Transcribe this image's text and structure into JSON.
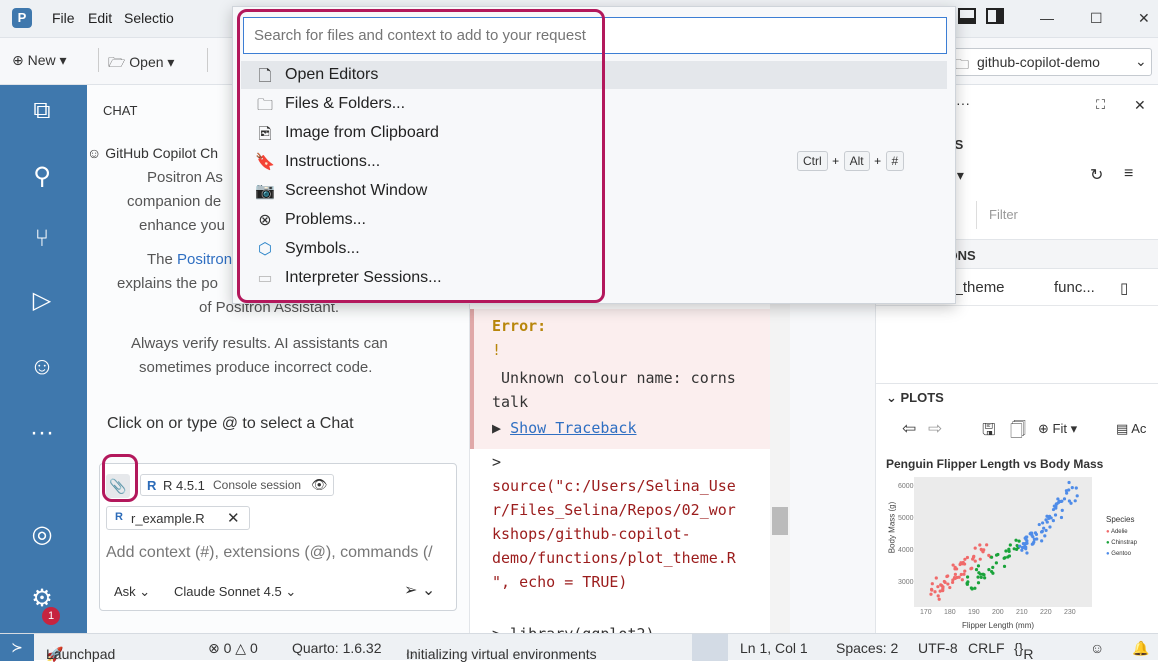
{
  "menubar": {
    "items": [
      "File",
      "Edit",
      "Selectio"
    ],
    "window_controls": [
      "—",
      "☐",
      "✕"
    ]
  },
  "toolbar": {
    "new_label": "New",
    "open_label": "Open",
    "workspace": "github-copilot-demo"
  },
  "quickpick": {
    "placeholder": "Search for files and context to add to your request",
    "items": [
      {
        "icon": "file-icon",
        "glyph": "🗋",
        "label": "Open Editors"
      },
      {
        "icon": "folder-icon",
        "glyph": "🗀",
        "label": "Files & Folders..."
      },
      {
        "icon": "image-clipboard-icon",
        "glyph": "🖻",
        "label": "Image from Clipboard"
      },
      {
        "icon": "bookmark-icon",
        "glyph": "🔖",
        "label": "Instructions..."
      },
      {
        "icon": "camera-icon",
        "glyph": "📷",
        "label": "Screenshot Window"
      },
      {
        "icon": "error-circle-icon",
        "glyph": "⊗",
        "label": "Problems..."
      },
      {
        "icon": "cube-icon",
        "glyph": "⬡",
        "label": "Symbols..."
      },
      {
        "icon": "terminal-icon",
        "glyph": "▭",
        "label": "Interpreter Sessions..."
      }
    ],
    "shortcut": [
      "Ctrl",
      "+",
      "Alt",
      "+",
      "#"
    ]
  },
  "chat": {
    "header": "CHAT",
    "welcome_line1": "GitHub Copilot Ch",
    "welcome_line2": "Positron As",
    "welcome_line3": "companion de",
    "welcome_line4": "enhance you",
    "positron_prefix": "The ",
    "positron_link": "Positron",
    "explains": "explains the po",
    "of_positron": "of Positron Assistant.",
    "verify1": "Always verify results. AI assistants can",
    "verify2": "sometimes produce incorrect code.",
    "select_chat": "Click on or type @ to select a Chat",
    "session_label": "R 4.5.1",
    "session_sub": "Console session",
    "file_chip": "r_example.R",
    "input_placeholder": "Add context (#), extensions (@), commands (/",
    "mode": "Ask",
    "model": "Claude Sonnet 4.5"
  },
  "console": {
    "error_label": "Error:",
    "bang": "!",
    "error_msg1": " Unknown colour name: corns",
    "error_msg2": "talk",
    "traceback": "Show Traceback",
    "prompt": ">",
    "source_lines": [
      "source(\"c:/Users/Selina_Use",
      "r/Files_Selina/Repos/02_wor",
      "kshops/github-copilot-",
      "demo/functions/plot_theme.R",
      "\", echo = TRUE)"
    ],
    "next_line": "> library(ggplot2)"
  },
  "right": {
    "header_frag": "N",
    "vars_frag": "LES",
    "filter_placeholder": "Filter",
    "functions_frag": "TIONS",
    "func_row_name": "m_theme",
    "func_row_type": "func...",
    "plots_header": "PLOTS",
    "fit_label": "Fit",
    "ac_frag": "Ac"
  },
  "plot": {
    "title": "Penguin Flipper Length vs Body Mass",
    "ylabel": "Body Mass (g)",
    "xlabel": "Flipper Length (mm)",
    "legend_title": "Species",
    "legend": [
      "Adelie",
      "Chinstrap",
      "Gentoo"
    ],
    "colors": [
      "#f06a6a",
      "#1aa33a",
      "#4f8ce8"
    ],
    "yticks": [
      "6000",
      "5000",
      "4000",
      "3000"
    ],
    "xticks": [
      "170",
      "180",
      "190",
      "200",
      "210",
      "220",
      "230"
    ]
  },
  "status": {
    "launchpad": "Launchpad",
    "problems": "⊗ 0 △ 0",
    "quarto": "Quarto: 1.6.32",
    "init": "Initializing virtual environments",
    "position": "Ln 1, Col 1",
    "spaces": "Spaces: 2",
    "encoding": "UTF-8",
    "eol": "CRLF",
    "lang": "R",
    "badge": "1"
  }
}
